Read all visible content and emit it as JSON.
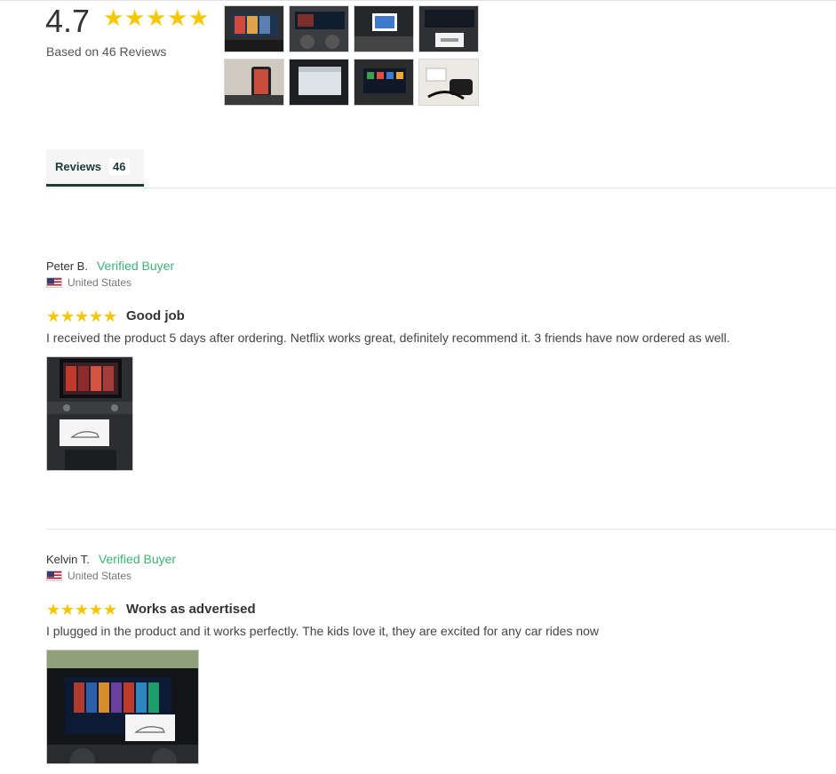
{
  "summary": {
    "rating": "4.7",
    "stars": 5,
    "based_on": "Based on 46 Reviews",
    "thumbnails": [
      {
        "icon": "car-screen-photo"
      },
      {
        "icon": "car-dashboard-photo"
      },
      {
        "icon": "car-display-photo"
      },
      {
        "icon": "car-display-box-photo"
      },
      {
        "icon": "phone-mount-photo"
      },
      {
        "icon": "car-screen-photo"
      },
      {
        "icon": "car-display-photo"
      },
      {
        "icon": "product-box-photo"
      }
    ]
  },
  "tabs": [
    {
      "label": "Reviews",
      "count": "46"
    }
  ],
  "reviews": [
    {
      "name": "Peter B.",
      "badge": "Verified Buyer",
      "country": "United States",
      "rating": 5,
      "title": "Good job",
      "body": "I received the product 5 days after ordering. Netflix works great, definitely recommend it. 3 friends have now ordered as well.",
      "photo_icon": "car-screen-photo"
    },
    {
      "name": "Kelvin T.",
      "badge": "Verified Buyer",
      "country": "United States",
      "rating": 5,
      "title": "Works as advertised",
      "body": "I plugged in the product and it works perfectly. The kids love it, they are excited for any car rides now",
      "photo_icon": "car-screen-photo"
    }
  ],
  "colors": {
    "star": "#f7c600",
    "verified": "#3bb274",
    "tab_accent": "#1d3b36"
  }
}
